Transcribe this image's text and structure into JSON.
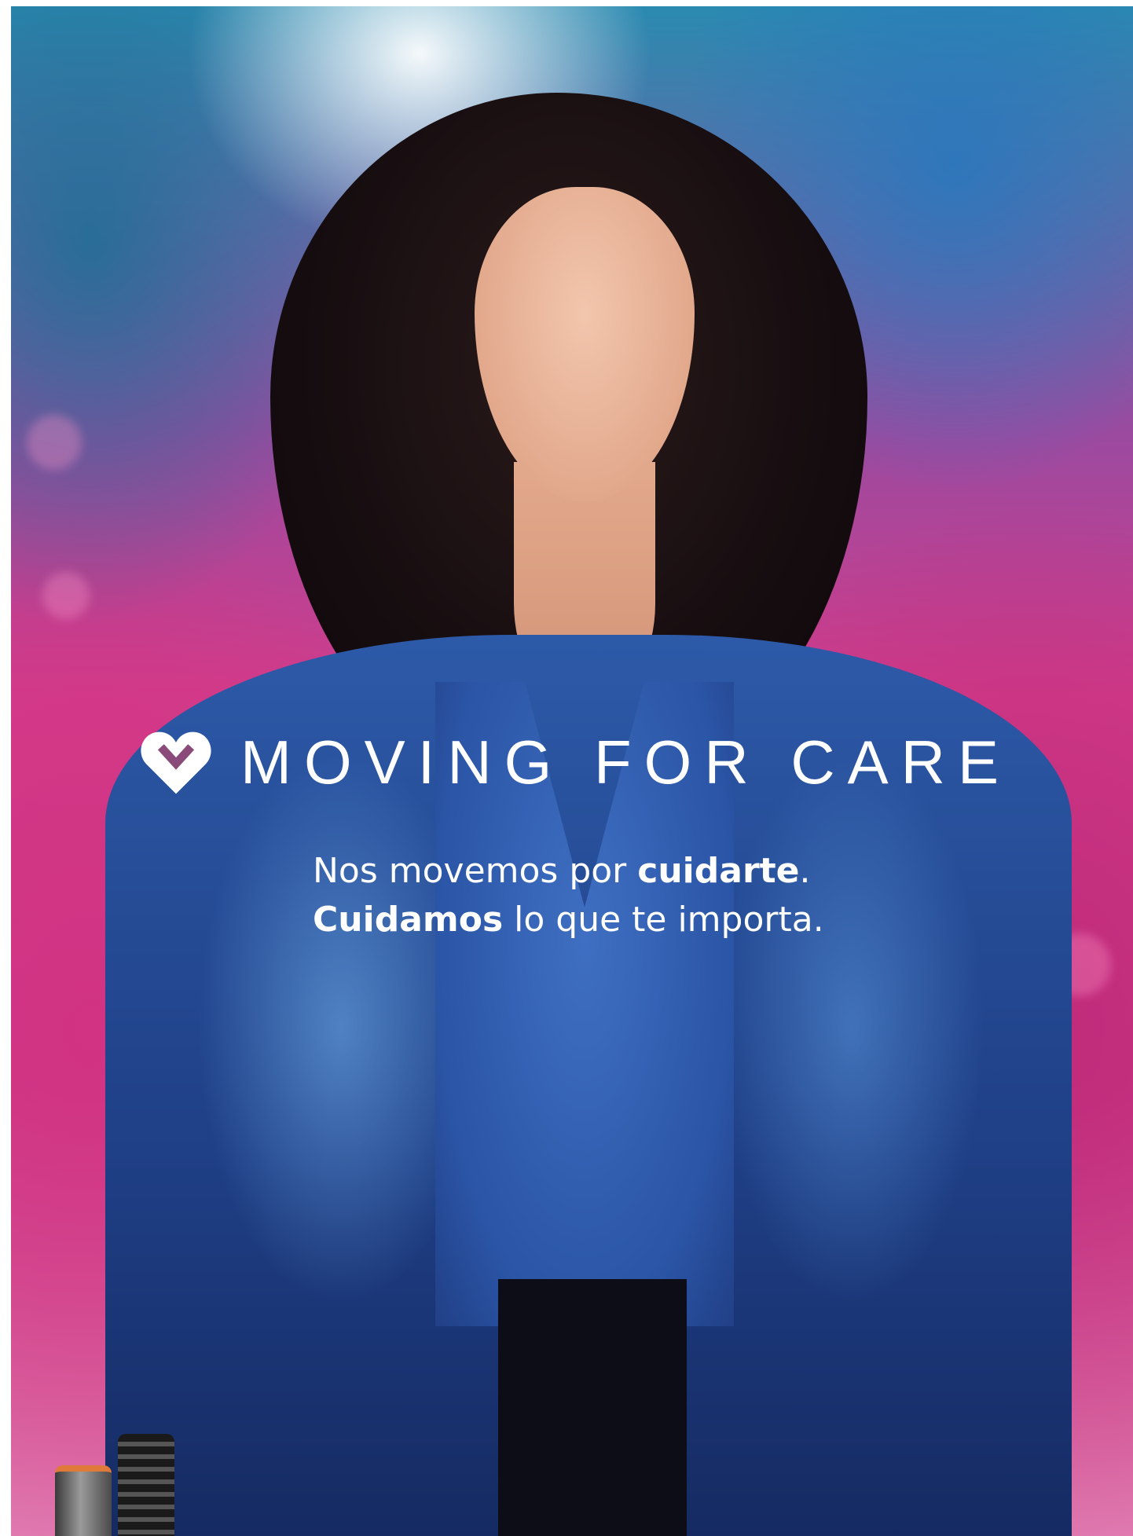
{
  "brand": {
    "name": "MOVING FOR CARE",
    "icon": "heart-icon"
  },
  "tagline": {
    "line1_a": "Nos movemos por ",
    "line1_b": "cuidarte",
    "line1_c": ".",
    "line2_a": "Cuidamos",
    "line2_b": " lo que te importa."
  },
  "colors": {
    "text": "#ffffff",
    "accent_pink": "#d23c8a",
    "accent_blue": "#2d5aa8"
  }
}
